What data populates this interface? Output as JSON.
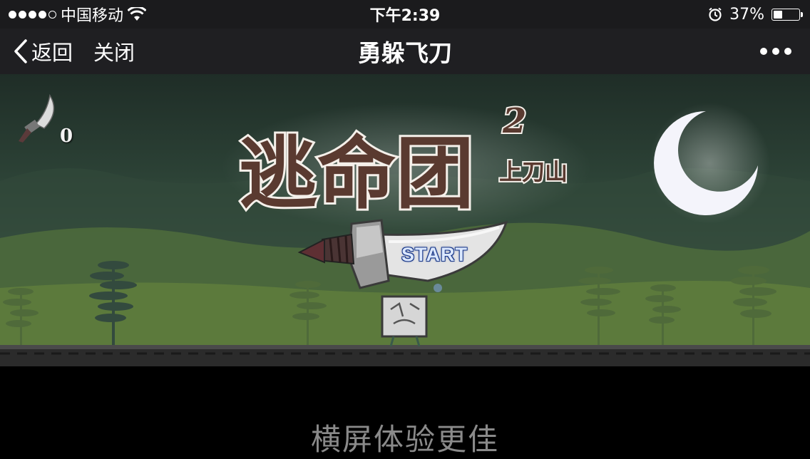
{
  "status_bar": {
    "carrier": "中国移动",
    "time": "下午2:39",
    "battery_text": "37%",
    "battery_level": 0.37,
    "icons": [
      "signal-dots-icon",
      "wifi-icon",
      "alarm-icon",
      "battery-icon"
    ]
  },
  "nav": {
    "back_label": "返回",
    "close_label": "关闭",
    "title": "勇躲飞刀",
    "more_icon": "more-dots-icon"
  },
  "game": {
    "knife_count": "0",
    "logo_title": "逃命团",
    "logo_number": "2",
    "logo_subtitle": "上刀山",
    "start_label": "START"
  },
  "footer": {
    "hint": "横屏体验更佳"
  },
  "colors": {
    "status_bar_bg": "#1b1b1d",
    "nav_bg": "#1f1f22",
    "hint_text": "#8a8a8a"
  }
}
